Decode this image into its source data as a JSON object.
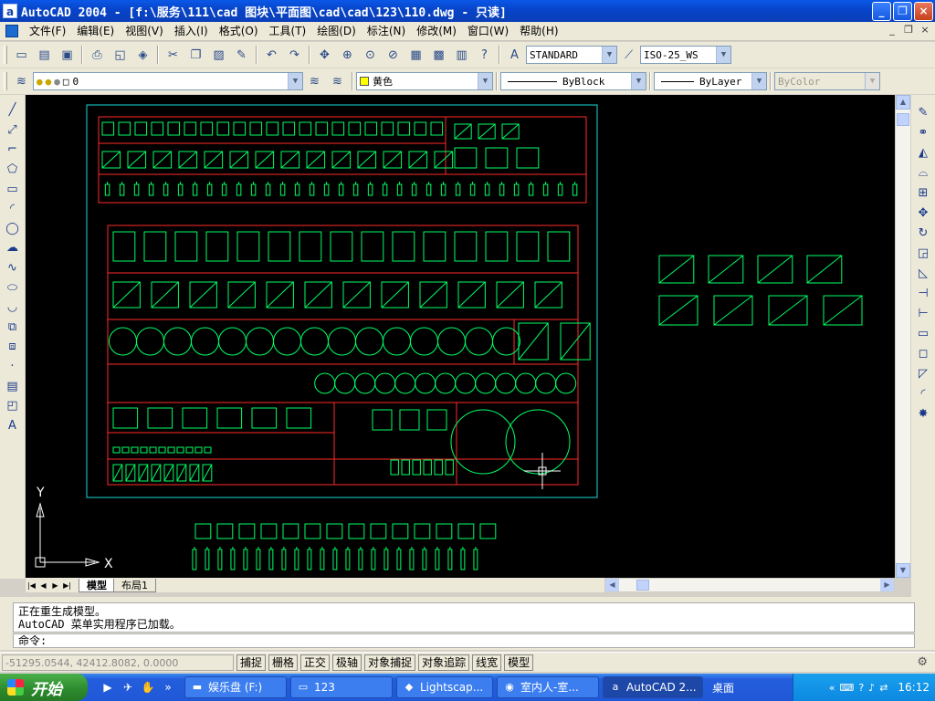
{
  "window": {
    "title": "AutoCAD 2004 - [f:\\服务\\111\\cad 图块\\平面图\\cad\\cad\\123\\110.dwg - 只读]",
    "app_icon": "a",
    "buttons": [
      "_",
      "❐",
      "×"
    ]
  },
  "menu": {
    "items": [
      "文件(F)",
      "编辑(E)",
      "视图(V)",
      "插入(I)",
      "格式(O)",
      "工具(T)",
      "绘图(D)",
      "标注(N)",
      "修改(M)",
      "窗口(W)",
      "帮助(H)"
    ],
    "doc_controls": [
      "_",
      "❐",
      "×"
    ]
  },
  "toolbar": {
    "text_style": "STANDARD",
    "dim_style": "ISO-25_WS",
    "layer": "0",
    "color": "黄色",
    "color_hex": "#ffff00",
    "linetype": "ByBlock",
    "lineweight": "ByLayer",
    "plotstyle": "ByColor"
  },
  "canvas": {
    "background": "#000000",
    "accent_green": "#00ff66",
    "frame_cyan": "#19d7d7",
    "grid_red": "#ff2a2a",
    "axis_x": "X",
    "axis_y": "Y"
  },
  "tabs": {
    "model": "模型",
    "layout1": "布局1"
  },
  "command": {
    "history": [
      "正在重生成模型。",
      "AutoCAD 菜单实用程序已加载。"
    ],
    "prompt": "命令:"
  },
  "status": {
    "coords": "-51295.0544, 42412.8082, 0.0000",
    "toggles": [
      "捕捉",
      "栅格",
      "正交",
      "极轴",
      "对象捕捉",
      "对象追踪",
      "线宽",
      "模型"
    ]
  },
  "taskbar": {
    "start": "开始",
    "tasks": [
      "娱乐盘 (F:)",
      "123",
      "Lightscap...",
      "室内人-室...",
      "AutoCAD 2..."
    ],
    "desktop": "桌面",
    "clock": "16:12"
  }
}
